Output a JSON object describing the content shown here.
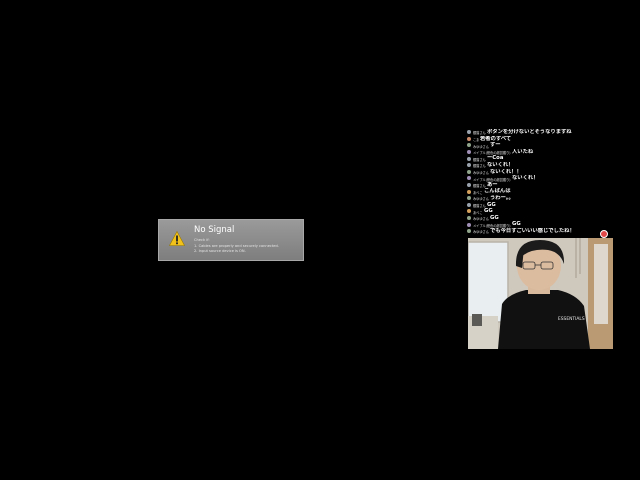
{
  "dialog": {
    "title": "No Signal",
    "check_text": "Check if:",
    "line1": "1. Cables are properly and securely connected.",
    "line2": "2. Input source device is ON."
  },
  "chat": {
    "messages": [
      {
        "name": "銀猫さん",
        "text": "ボタンを分けないとそうなりますね",
        "avatar": "#9aa3ad"
      },
      {
        "name": "こま",
        "text": "若者のすべて",
        "avatar": "#c98a6a"
      },
      {
        "name": "みゆゆさん",
        "text": "すー",
        "avatar": "#8fa48a"
      },
      {
        "name": "メイプル(鉛色の超賞獲り)",
        "text": "人いたね",
        "avatar": "#a08fb6"
      },
      {
        "name": "銀猫さん",
        "text": "ーCoa",
        "avatar": "#9aa3ad"
      },
      {
        "name": "銀猫さん",
        "text": "ないくれ！",
        "avatar": "#9aa3ad"
      },
      {
        "name": "みゆゆさん",
        "text": "ないくれ！！",
        "avatar": "#8fa48a"
      },
      {
        "name": "メイプル(鉛色の超賞獲り)",
        "text": "ないくれ！",
        "avatar": "#a08fb6"
      },
      {
        "name": "銀猫さん",
        "text": "あー",
        "avatar": "#9aa3ad"
      },
      {
        "name": "あべこ",
        "text": "こんばんは",
        "avatar": "#d4a05c"
      },
      {
        "name": "みゆゆさん",
        "text": "うわー。。",
        "avatar": "#8fa48a"
      },
      {
        "name": "銀猫さん",
        "text": "GG",
        "avatar": "#9aa3ad"
      },
      {
        "name": "あべこ",
        "text": "GG",
        "avatar": "#d4a05c"
      },
      {
        "name": "みゆゆさん",
        "text": "GG",
        "avatar": "#8fa48a"
      },
      {
        "name": "メイプル(鉛色の超賞獲り)",
        "text": "GG",
        "avatar": "#a08fb6"
      },
      {
        "name": "みゆゆさん",
        "text": "でも今日すごいいい感じでしたね！",
        "avatar": "#8fa48a"
      }
    ]
  },
  "webcam": {
    "shirt_text": "ESSENTIALS"
  }
}
